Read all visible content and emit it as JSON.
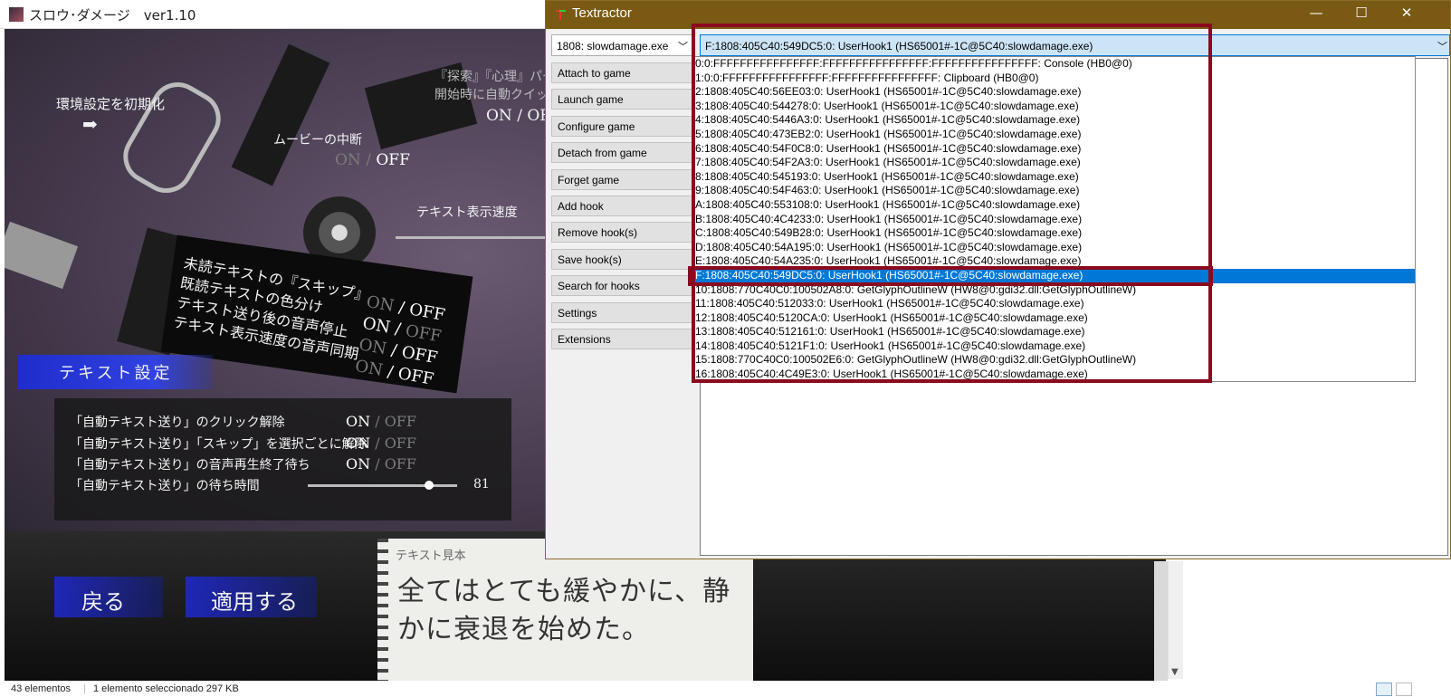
{
  "game": {
    "title": "スロウ･ダメージ　ver1.10",
    "reset_label": "環境設定を初期化",
    "reset_arrow": "➡",
    "movie_skip_label": "ムービーの中断",
    "movie_on": "ON",
    "movie_sep": " / ",
    "movie_off": "OFF",
    "top_right_line1": "『探索』『心理』パー",
    "top_right_line2": "開始時に自動クイッ",
    "top_right_on": "ON / OF",
    "text_speed_label": "テキスト表示速度",
    "skip_block": [
      {
        "label": "未読テキストの『スキップ』",
        "on": "ON",
        "off": "OFF"
      },
      {
        "label": "既読テキストの色分け",
        "on": "ON",
        "off": "OFF"
      },
      {
        "label": "テキスト送り後の音声停止",
        "on": "ON",
        "off": "OFF"
      },
      {
        "label": "テキスト表示速度の音声同期",
        "on": "ON",
        "off": "OFF"
      }
    ],
    "section_title": "テキスト設定",
    "auto_settings": [
      {
        "label": "「自動テキスト送り」のクリック解除",
        "on": "ON",
        "off": "OFF"
      },
      {
        "label": "「自動テキスト送り」「スキップ」を選択ごとに解除",
        "on": "ON",
        "off": "OFF"
      },
      {
        "label": "「自動テキスト送り」の音声再生終了待ち",
        "on": "ON",
        "off": "OFF"
      }
    ],
    "wait_time_label": "「自動テキスト送り」の待ち時間",
    "wait_time_value": "81",
    "wait_time_fraction": 0.81,
    "sample_label": "テキスト見本",
    "sample_text": "全てはとても緩やかに、静かに衰退を始めた。",
    "back_button": "戻る",
    "apply_button": "適用する"
  },
  "textractor": {
    "title": "Textractor",
    "window_controls": {
      "minimize": "—",
      "maximize": "☐",
      "close": "✕"
    },
    "process_selected": "1808: slowdamage.exe",
    "buttons": [
      "Attach to game",
      "Launch game",
      "Configure game",
      "Detach from game",
      "Forget game",
      "Add hook",
      "Remove hook(s)",
      "Save hook(s)",
      "Search for hooks",
      "Settings",
      "Extensions"
    ],
    "hook_selected": "F:1808:405C40:549DC5:0: UserHook1 (HS65001#-1C@5C40:slowdamage.exe)",
    "hook_list": [
      "0:0:FFFFFFFFFFFFFFFF:FFFFFFFFFFFFFFFF:FFFFFFFFFFFFFFFF: Console (HB0@0)",
      "1:0:0:FFFFFFFFFFFFFFFF:FFFFFFFFFFFFFFFF: Clipboard (HB0@0)",
      "2:1808:405C40:56EE03:0: UserHook1 (HS65001#-1C@5C40:slowdamage.exe)",
      "3:1808:405C40:544278:0: UserHook1 (HS65001#-1C@5C40:slowdamage.exe)",
      "4:1808:405C40:5446A3:0: UserHook1 (HS65001#-1C@5C40:slowdamage.exe)",
      "5:1808:405C40:473EB2:0: UserHook1 (HS65001#-1C@5C40:slowdamage.exe)",
      "6:1808:405C40:54F0C8:0: UserHook1 (HS65001#-1C@5C40:slowdamage.exe)",
      "7:1808:405C40:54F2A3:0: UserHook1 (HS65001#-1C@5C40:slowdamage.exe)",
      "8:1808:405C40:545193:0: UserHook1 (HS65001#-1C@5C40:slowdamage.exe)",
      "9:1808:405C40:54F463:0: UserHook1 (HS65001#-1C@5C40:slowdamage.exe)",
      "A:1808:405C40:553108:0: UserHook1 (HS65001#-1C@5C40:slowdamage.exe)",
      "B:1808:405C40:4C4233:0: UserHook1 (HS65001#-1C@5C40:slowdamage.exe)",
      "C:1808:405C40:549B28:0: UserHook1 (HS65001#-1C@5C40:slowdamage.exe)",
      "D:1808:405C40:54A195:0: UserHook1 (HS65001#-1C@5C40:slowdamage.exe)",
      "E:1808:405C40:54A235:0: UserHook1 (HS65001#-1C@5C40:slowdamage.exe)",
      "F:1808:405C40:549DC5:0: UserHook1 (HS65001#-1C@5C40:slowdamage.exe)",
      "10:1808:770C40C0:100502A8:0: GetGlyphOutlineW (HW8@0:gdi32.dll:GetGlyphOutlineW)",
      "11:1808:405C40:512033:0: UserHook1 (HS65001#-1C@5C40:slowdamage.exe)",
      "12:1808:405C40:5120CA:0: UserHook1 (HS65001#-1C@5C40:slowdamage.exe)",
      "13:1808:405C40:512161:0: UserHook1 (HS65001#-1C@5C40:slowdamage.exe)",
      "14:1808:405C40:5121F1:0: UserHook1 (HS65001#-1C@5C40:slowdamage.exe)",
      "15:1808:770C40C0:100502E6:0: GetGlyphOutlineW (HW8@0:gdi32.dll:GetGlyphOutlineW)",
      "16:1808:405C40:4C49E3:0: UserHook1 (HS65001#-1C@5C40:slowdamage.exe)"
    ],
    "selected_index": 15,
    "accent_color": "#0078d7",
    "titlebar_color": "#7a5a12",
    "highlight_color": "#8b0a1e"
  },
  "explorer_status": {
    "items_count": "43 elementos",
    "selected": "1 elemento seleccionado  297 KB"
  }
}
